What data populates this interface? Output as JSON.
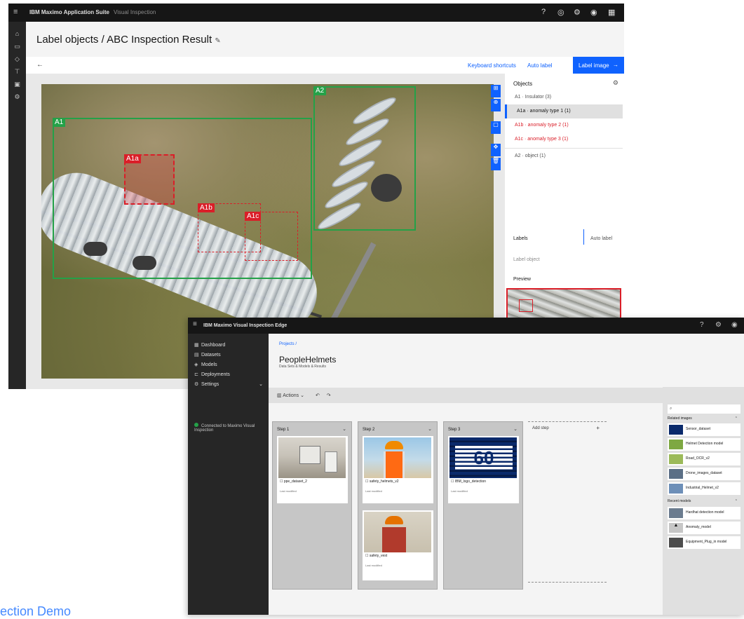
{
  "label_window": {
    "brand": "IBM Maximo Application Suite",
    "product": "Visual Inspection",
    "page_title": "Label objects / ABC Inspection Result",
    "toolbar": {
      "back_symbol": "←",
      "keyboard_shortcuts": "Keyboard shortcuts",
      "label_as": "Auto label",
      "done_button": "Label image"
    },
    "boxes": [
      {
        "label": "A1",
        "type": "object"
      },
      {
        "label": "A2",
        "type": "object"
      },
      {
        "label": "A1a",
        "type": "anomaly"
      },
      {
        "label": "A1b",
        "type": "anomaly"
      },
      {
        "label": "A1c",
        "type": "anomaly"
      }
    ],
    "panel": {
      "heading": "Objects",
      "rows": [
        "A1 · Insulator (3)",
        "A1a · anomaly type 1 (1)",
        "A1b · anomaly type 2 (1)",
        "A1c · anomaly type 3 (1)"
      ],
      "row_after": "A2 · object (1)",
      "labels_heading": "Labels",
      "labels_tab": "Auto label",
      "labels_placeholder": "Label object",
      "preview_heading": "Preview"
    },
    "colors": {
      "object": "#24a148",
      "anomaly": "#da1e28",
      "accent": "#0f62fe"
    }
  },
  "inspect_window": {
    "brand": "IBM Maximo Visual Inspection Edge",
    "nav": [
      "Dashboard",
      "Datasets",
      "Models",
      "Deployments",
      "Settings"
    ],
    "connection": "Connected to Maximo Visual Inspection",
    "breadcrumb": "Projects  /",
    "title": "PeopleHelmets",
    "subtitle": "Data Sets & Models & Results",
    "toolbar": "Actions",
    "columns": [
      {
        "name": "Step 1",
        "cards": [
          {
            "caption": "ppe_dataset_2",
            "meta": "Last modified"
          }
        ]
      },
      {
        "name": "Step 2",
        "cards": [
          {
            "caption": "safety_helmets_v2",
            "meta": "Last modified"
          },
          {
            "caption": "safety_vest",
            "meta": "Last modified"
          }
        ]
      },
      {
        "name": "Step 3",
        "cards": [
          {
            "caption": "IBM_logo_detection",
            "meta": "Last modified"
          }
        ]
      }
    ],
    "new_column": "Add step",
    "new_column_symbol": "+",
    "right_panel": {
      "search": "",
      "groups": [
        {
          "name": "Related images",
          "items": [
            "Sensor_dataset",
            "Helmet Detection model",
            "Road_OCR_v2",
            "Drone_images_dataset",
            "Industrial_Helmet_v2"
          ]
        },
        {
          "name": "Recent models",
          "items": [
            "Hardhat detection model",
            "Anomaly_model",
            "Equipment_Plug_in model"
          ]
        }
      ]
    },
    "ibm_logo_text": "60"
  },
  "caption": "ection Demo"
}
